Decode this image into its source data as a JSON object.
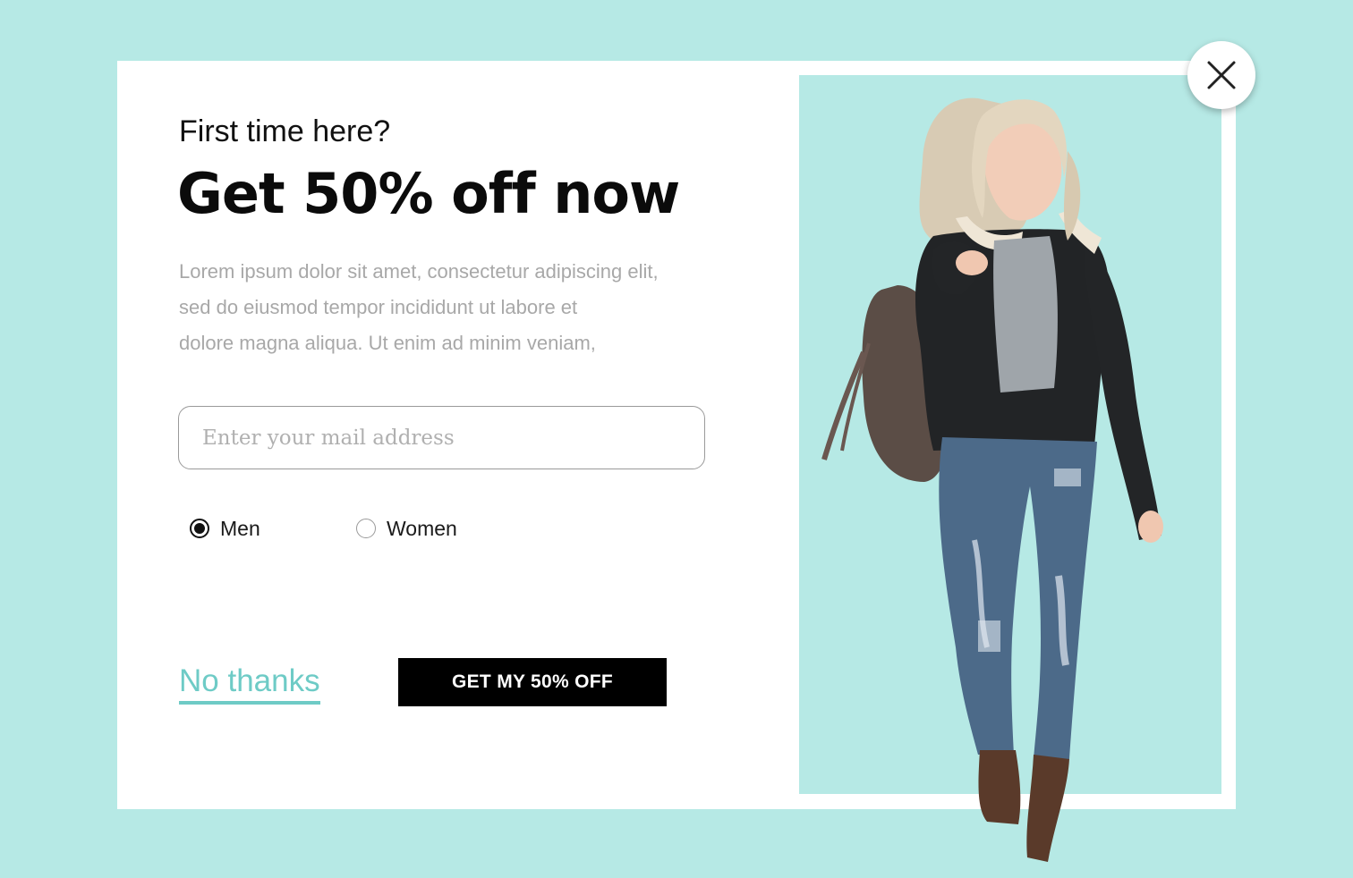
{
  "popup": {
    "subtitle": "First time here?",
    "headline": "Get 50% off now",
    "body_lines": [
      "Lorem ipsum dolor sit amet, consectetur adipiscing elit,",
      "sed do eiusmod tempor incididunt ut labore et",
      "dolore magna aliqua. Ut enim ad minim veniam,"
    ],
    "email": {
      "placeholder": "Enter your mail address",
      "value": ""
    },
    "gender_options": [
      {
        "label": "Men",
        "selected": true
      },
      {
        "label": "Women",
        "selected": false
      }
    ],
    "decline_label": "No thanks",
    "cta_label": "GET MY 50% OFF",
    "close_icon": "close-icon"
  },
  "theme": {
    "background": "#b6e9e5",
    "accent": "#6ecbc6",
    "cta_background": "#000000",
    "cta_text": "#ffffff"
  }
}
